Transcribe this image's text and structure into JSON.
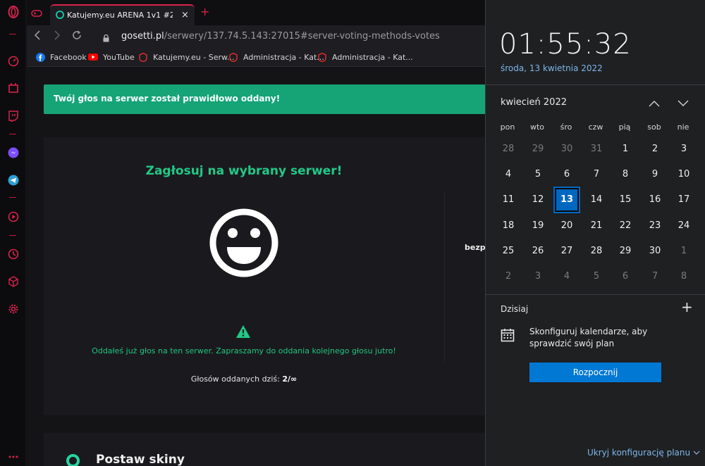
{
  "browser": {
    "tab_title": "Katujemy.eu ARENA 1v1 #2",
    "tab_close": "×",
    "new_tab": "+",
    "url_host": "gosetti.pl",
    "url_path": "/serwery/137.74.5.143:27015#server-voting-methods-votes",
    "bookmarks": [
      {
        "label": "Facebook",
        "icon": "facebook-icon"
      },
      {
        "label": "YouTube",
        "icon": "youtube-icon"
      },
      {
        "label": "Katujemy.eu - Serw...",
        "icon": "katujemy-icon"
      },
      {
        "label": "Administracja - Kat...",
        "icon": "katujemy-icon"
      },
      {
        "label": "Administracja - Kat...",
        "icon": "katujemy-icon"
      }
    ]
  },
  "page": {
    "toast": "Twój głos na serwer został prawidłowo oddany!",
    "vote_title": "Zagłosuj na wybrany serwer!",
    "notice": "Oddałeś już głos na ten serwer. Zapraszamy do oddania kolejnego głosu jutro!",
    "count_label": "Głosów oddanych dziś:",
    "count_value": "2/∞",
    "side_label": "bezp",
    "section_title": "Postaw skiny"
  },
  "calendar": {
    "time": "01:55:32",
    "date": "środa, 13 kwietnia 2022",
    "month": "kwiecień 2022",
    "weekdays": [
      "pon",
      "wto",
      "śro",
      "czw",
      "pią",
      "sob",
      "nie"
    ],
    "weeks": [
      [
        "28",
        "29",
        "30",
        "31",
        "1",
        "2",
        "3"
      ],
      [
        "4",
        "5",
        "6",
        "7",
        "8",
        "9",
        "10"
      ],
      [
        "11",
        "12",
        "13",
        "14",
        "15",
        "16",
        "17"
      ],
      [
        "18",
        "19",
        "20",
        "21",
        "22",
        "23",
        "24"
      ],
      [
        "25",
        "26",
        "27",
        "28",
        "29",
        "30",
        "1"
      ],
      [
        "2",
        "3",
        "4",
        "5",
        "6",
        "7",
        "8"
      ]
    ],
    "today_value": "13",
    "today_label": "Dzisiaj",
    "add_symbol": "+",
    "configure_text": "Skonfiguruj kalendarze, aby sprawdzić swój plan",
    "start_button": "Rozpocznij",
    "hide_link": "Ukryj konfigurację planu"
  },
  "colors": {
    "opera_red": "#d8234b",
    "toast_green": "#16a376",
    "accent_green": "#23c887",
    "windows_blue": "#0078d4"
  }
}
